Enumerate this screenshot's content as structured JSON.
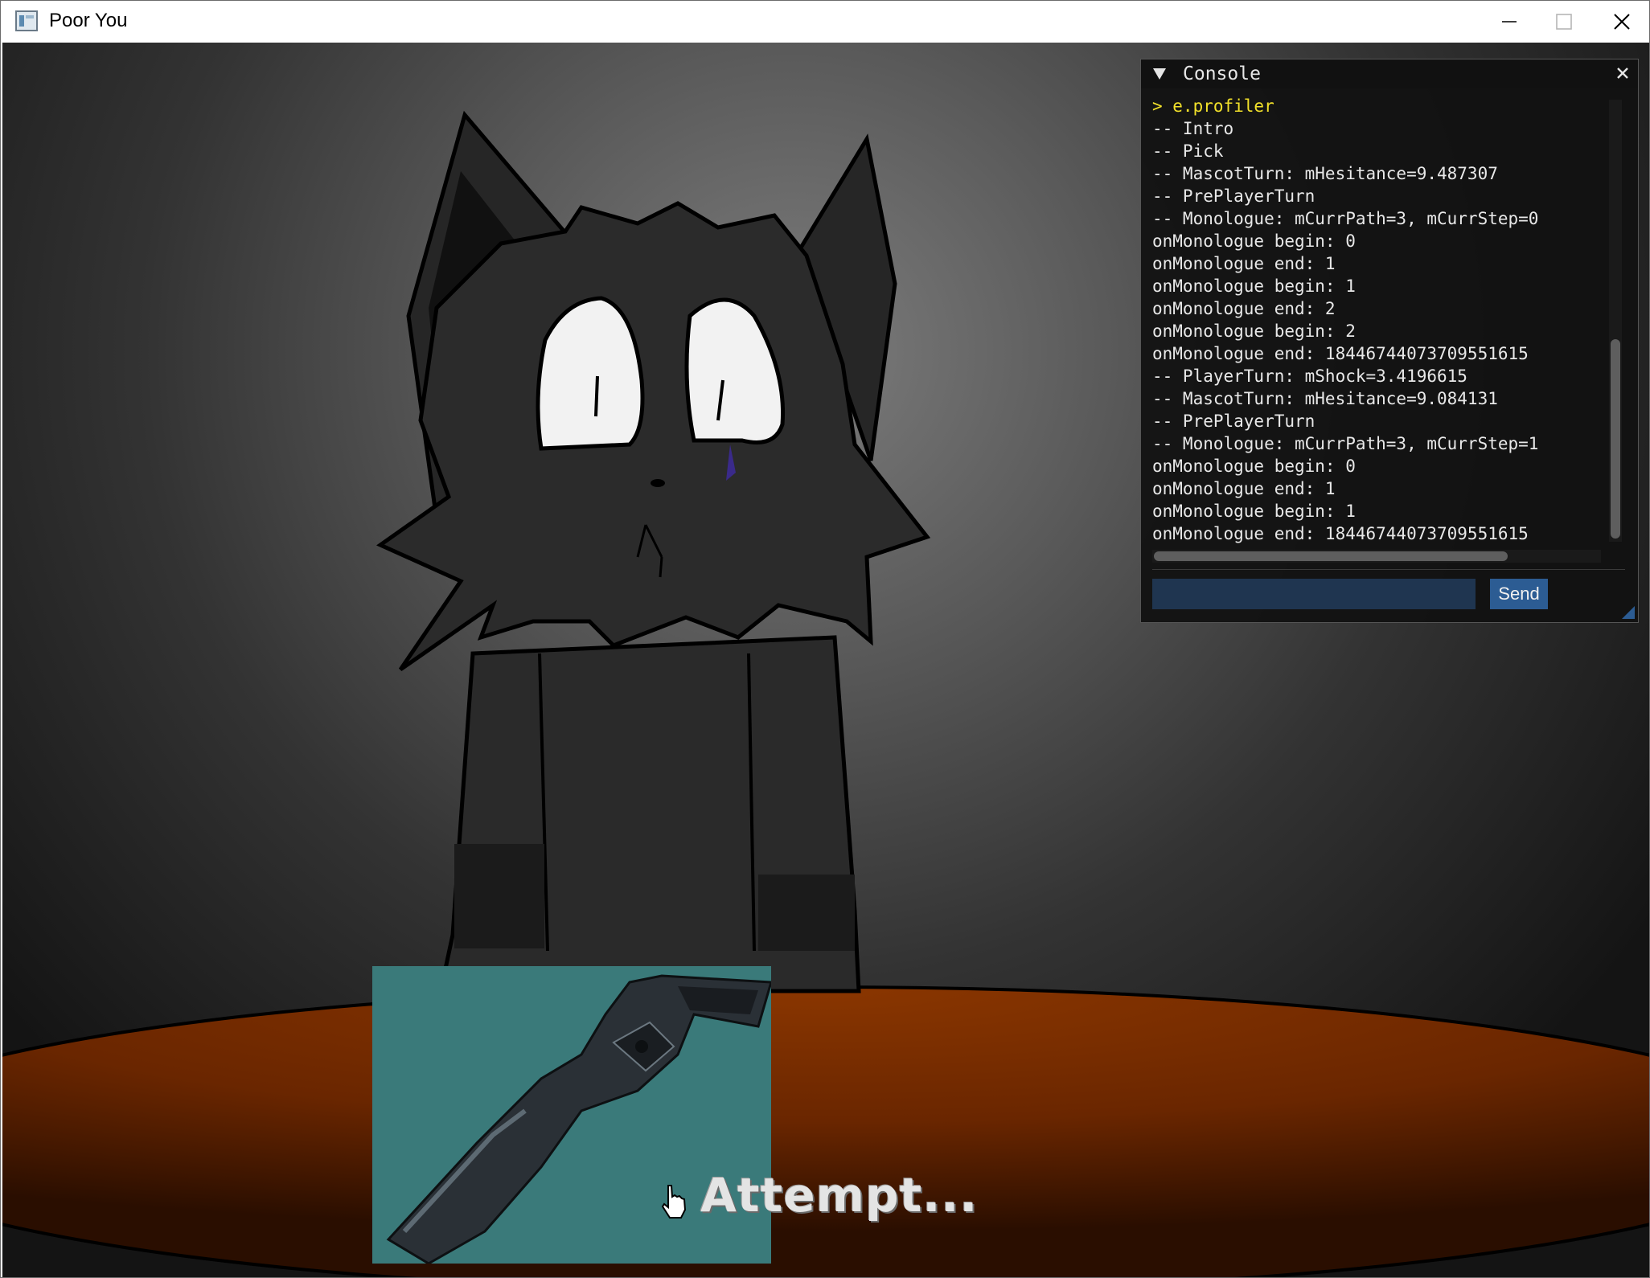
{
  "window": {
    "title": "Poor You",
    "icons": {
      "app": "app-icon",
      "minimize": "minimize-icon",
      "maximize": "maximize-icon",
      "close": "close-icon"
    }
  },
  "game": {
    "attempt_label": "Attempt...",
    "card_color": "#3a7a7a",
    "table_color": "#7a2e00"
  },
  "console": {
    "title": "Console",
    "collapse_icon": "triangle-down-icon",
    "close_icon": "close-icon",
    "log": [
      "> e.profiler",
      "-- Intro",
      "-- Pick",
      "-- MascotTurn: mHesitance=9.487307",
      "-- PrePlayerTurn",
      "-- Monologue: mCurrPath=3, mCurrStep=0",
      "onMonologue begin: 0",
      "onMonologue end: 1",
      "onMonologue begin: 1",
      "onMonologue end: 2",
      "onMonologue begin: 2",
      "onMonologue end: 18446744073709551615",
      "-- PlayerTurn: mShock=3.4196615",
      "-- MascotTurn: mHesitance=9.084131",
      "-- PrePlayerTurn",
      "-- Monologue: mCurrPath=3, mCurrStep=1",
      "onMonologue begin: 0",
      "onMonologue end: 1",
      "onMonologue begin: 1",
      "onMonologue end: 18446744073709551615"
    ],
    "input_value": "",
    "send_label": "Send",
    "command_color": "#f2e12a",
    "accent_color": "#2c5c93"
  }
}
